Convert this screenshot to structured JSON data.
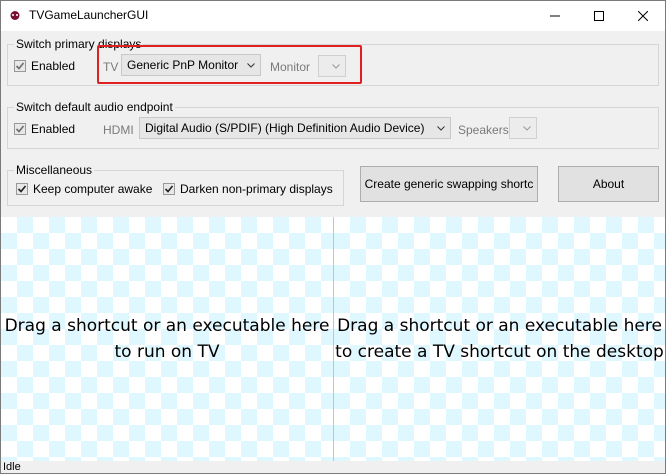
{
  "window": {
    "title": "TVGameLauncherGUI",
    "accent": "#e02020"
  },
  "primary_displays": {
    "group_label": "Switch primary displays",
    "enabled_label": "Enabled",
    "enabled": true,
    "device_label": "TV",
    "monitor_value": "Generic PnP Monitor",
    "secondary_label": "Monitor",
    "secondary_value": ""
  },
  "audio": {
    "group_label": "Switch default audio endpoint",
    "enabled_label": "Enabled",
    "enabled": true,
    "device_label": "HDMI",
    "device_value": "Digital Audio (S/PDIF) (High Definition Audio Device)",
    "secondary_label": "Speakers",
    "secondary_value": ""
  },
  "misc": {
    "group_label": "Miscellaneous",
    "keep_awake_label": "Keep computer awake",
    "keep_awake": true,
    "darken_label": "Darken non-primary displays",
    "darken": true
  },
  "buttons": {
    "create_shortcut": "Create generic swapping shortc",
    "about": "About"
  },
  "dropzones": {
    "run_line1": "Drag a shortcut or an executable here",
    "run_line2": "to run on TV",
    "create_line1": "Drag a shortcut or an executable here",
    "create_line2": "to create a TV shortcut on the desktop"
  },
  "status": {
    "text": "Idle"
  }
}
